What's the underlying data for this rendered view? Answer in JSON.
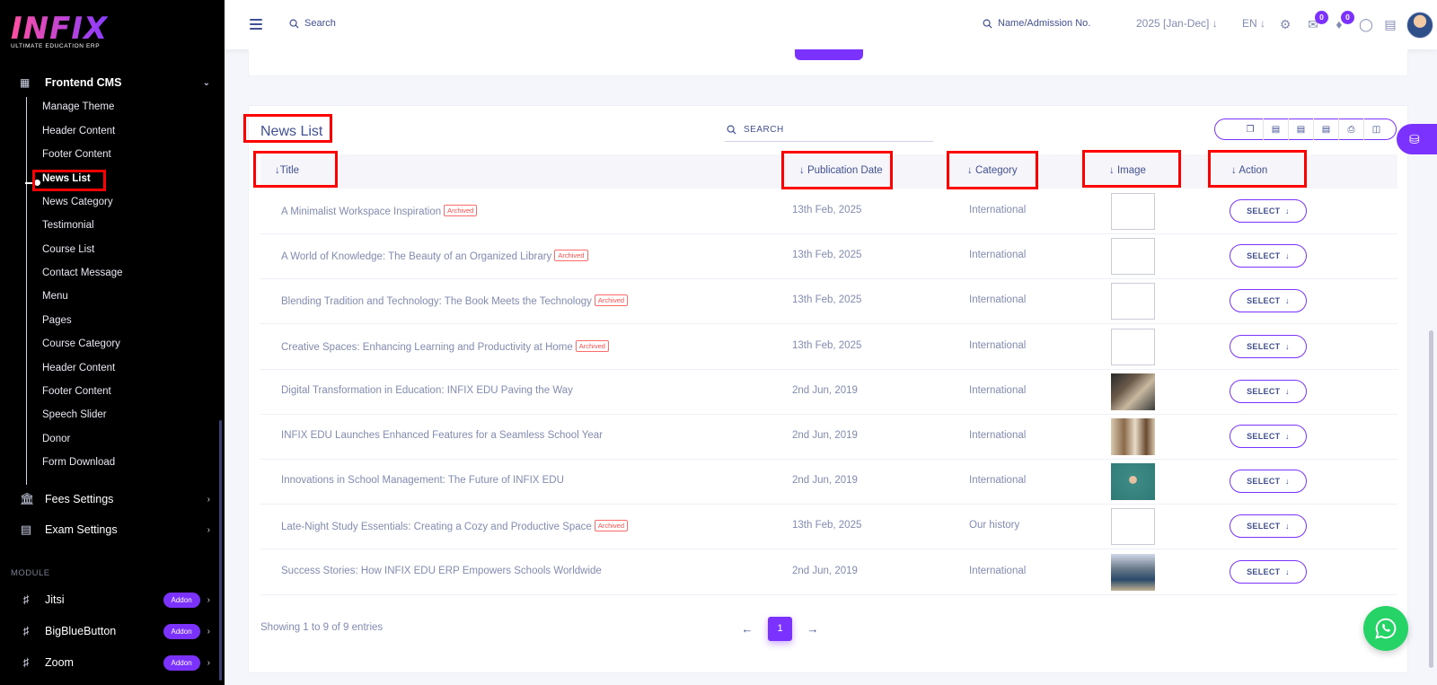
{
  "brand": {
    "logo": "INFIX",
    "tagline": "ULTIMATE EDUCATION ERP"
  },
  "sidebar": {
    "section": "Frontend CMS",
    "sub_items": [
      "Manage Theme",
      "Header Content",
      "Footer Content",
      "News List",
      "News Category",
      "Testimonial",
      "Course List",
      "Contact Message",
      "Menu",
      "Pages",
      "Course Category",
      "Header Content",
      "Footer Content",
      "Speech Slider",
      "Donor",
      "Form Download"
    ],
    "active": "News List",
    "groups": [
      "Fees Settings",
      "Exam Settings"
    ],
    "module_label": "MODULE",
    "modules": [
      {
        "label": "Jitsi",
        "badge": "Addon"
      },
      {
        "label": "BigBlueButton",
        "badge": "Addon"
      },
      {
        "label": "Zoom",
        "badge": "Addon"
      }
    ]
  },
  "topbar": {
    "search_placeholder": "Search",
    "student_search_placeholder": "Name/Admission No.",
    "year": "2025 [Jan-Dec]",
    "language": "EN",
    "chat_count": "0",
    "notification_count": "0"
  },
  "card": {
    "title": "News List",
    "search_placeholder": "SEARCH",
    "columns": [
      "Title",
      "Publication Date",
      "Category",
      "Image",
      "Action"
    ],
    "rows": [
      {
        "title": "A Minimalist Workspace Inspiration",
        "archived": "Archived",
        "date": "13th Feb, 2025",
        "category": "International",
        "image": "broken",
        "action": "SELECT"
      },
      {
        "title": "A World of Knowledge: The Beauty of an Organized Library",
        "archived": "Archived",
        "date": "13th Feb, 2025",
        "category": "International",
        "image": "broken",
        "action": "SELECT"
      },
      {
        "title": "Blending Tradition and Technology: The Book Meets the Technology",
        "archived": "Archived",
        "date": "13th Feb, 2025",
        "category": "International",
        "image": "broken",
        "action": "SELECT"
      },
      {
        "title": "Creative Spaces: Enhancing Learning and Productivity at Home",
        "archived": "Archived",
        "date": "13th Feb, 2025",
        "category": "International",
        "image": "broken",
        "action": "SELECT"
      },
      {
        "title": "Digital Transformation in Education: INFIX EDU Paving the Way",
        "archived": "",
        "date": "2nd Jun, 2019",
        "category": "International",
        "image": "photo1",
        "action": "SELECT"
      },
      {
        "title": "INFIX EDU Launches Enhanced Features for a Seamless School Year",
        "archived": "",
        "date": "2nd Jun, 2019",
        "category": "International",
        "image": "photo2",
        "action": "SELECT"
      },
      {
        "title": "Innovations in School Management: The Future of INFIX EDU",
        "archived": "",
        "date": "2nd Jun, 2019",
        "category": "International",
        "image": "photo3",
        "action": "SELECT"
      },
      {
        "title": "Late-Night Study Essentials: Creating a Cozy and Productive Space",
        "archived": "Archived",
        "date": "13th Feb, 2025",
        "category": "Our history",
        "image": "broken",
        "action": "SELECT"
      },
      {
        "title": "Success Stories: How INFIX EDU ERP Empowers Schools Worldwide",
        "archived": "",
        "date": "2nd Jun, 2019",
        "category": "International",
        "image": "photo4",
        "action": "SELECT"
      }
    ],
    "showing": "Showing 1 to 9 of 9 entries",
    "page": "1"
  },
  "colors": {
    "accent": "#7c32ff",
    "text": "#415094",
    "muted": "#828bb2",
    "highlight": "#ff0000",
    "whatsapp": "#25d366"
  }
}
